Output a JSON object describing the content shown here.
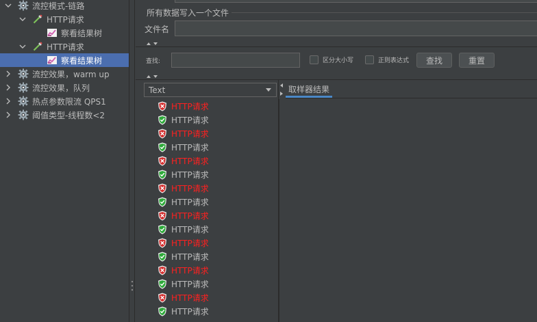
{
  "tree": {
    "nodes": [
      {
        "label": "流控模式-链路",
        "depth": 0,
        "icon": "gear-icon",
        "expanded": true,
        "selected": false
      },
      {
        "label": "HTTP请求",
        "depth": 1,
        "icon": "pipette-icon",
        "expanded": true,
        "selected": false
      },
      {
        "label": "察看结果树",
        "depth": 2,
        "icon": "chart-icon",
        "expanded": null,
        "selected": false
      },
      {
        "label": "HTTP请求",
        "depth": 1,
        "icon": "pipette-icon",
        "expanded": true,
        "selected": false
      },
      {
        "label": "察看结果树",
        "depth": 2,
        "icon": "chart-icon",
        "expanded": null,
        "selected": true
      },
      {
        "label": "流控效果，warm up",
        "depth": 0,
        "icon": "gear-icon",
        "expanded": false,
        "selected": false
      },
      {
        "label": "流控效果，队列",
        "depth": 0,
        "icon": "gear-icon",
        "expanded": false,
        "selected": false
      },
      {
        "label": "热点参数限流 QPS1",
        "depth": 0,
        "icon": "gear-icon",
        "expanded": false,
        "selected": false
      },
      {
        "label": "阈值类型-线程数<2",
        "depth": 0,
        "icon": "gear-icon",
        "expanded": false,
        "selected": false
      }
    ]
  },
  "file_section": {
    "title": "所有数据写入一个文件",
    "filename_label": "文件名",
    "filename_value": ""
  },
  "search": {
    "label": "查找:",
    "value": "",
    "case_sensitive_label": "区分大小写",
    "regex_label": "正则表达式",
    "find_button": "查找",
    "reset_button": "重置"
  },
  "renderer": {
    "selected": "Text"
  },
  "results": [
    {
      "label": "HTTP请求",
      "status": "fail"
    },
    {
      "label": "HTTP请求",
      "status": "ok"
    },
    {
      "label": "HTTP请求",
      "status": "fail"
    },
    {
      "label": "HTTP请求",
      "status": "ok"
    },
    {
      "label": "HTTP请求",
      "status": "fail"
    },
    {
      "label": "HTTP请求",
      "status": "ok"
    },
    {
      "label": "HTTP请求",
      "status": "fail"
    },
    {
      "label": "HTTP请求",
      "status": "ok"
    },
    {
      "label": "HTTP请求",
      "status": "fail"
    },
    {
      "label": "HTTP请求",
      "status": "ok"
    },
    {
      "label": "HTTP请求",
      "status": "fail"
    },
    {
      "label": "HTTP请求",
      "status": "ok"
    },
    {
      "label": "HTTP请求",
      "status": "fail"
    },
    {
      "label": "HTTP请求",
      "status": "ok"
    },
    {
      "label": "HTTP请求",
      "status": "fail"
    },
    {
      "label": "HTTP请求",
      "status": "ok"
    }
  ],
  "detail_tab": "取样器结果",
  "colors": {
    "fail": "#ff2020",
    "ok": "#bbbbbb",
    "selection": "#4b6eaf",
    "accent": "#4a88c7"
  }
}
